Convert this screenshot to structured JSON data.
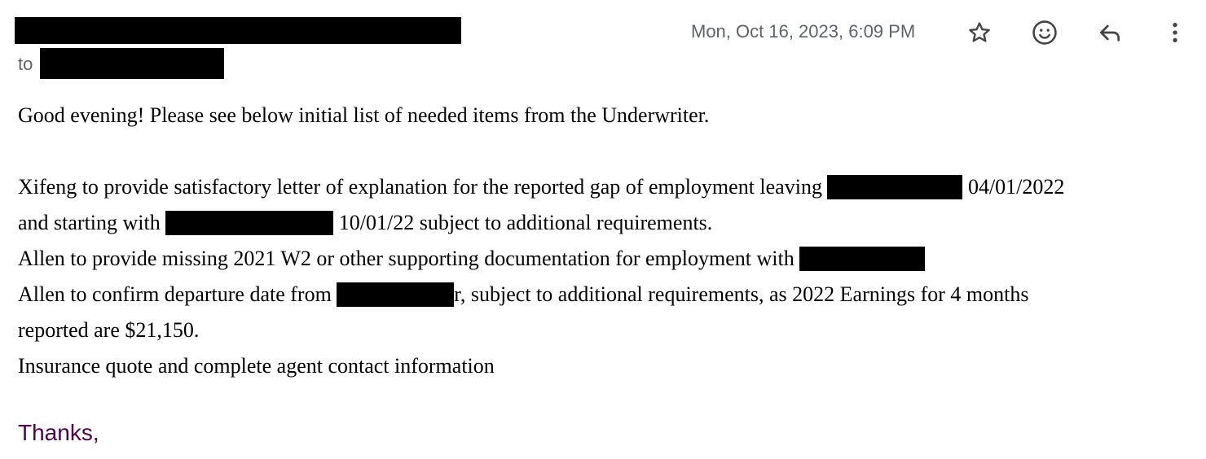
{
  "header": {
    "timestamp": "Mon, Oct 16, 2023, 6:09 PM",
    "to_label": "to",
    "icons": [
      "star-icon",
      "emoji-icon",
      "reply-icon",
      "more-vert-icon"
    ]
  },
  "body": {
    "greeting": "Good evening!  Please see below initial list of needed items from the Underwriter.",
    "item1_part1": "Xifeng to provide satisfactory letter of explanation for the reported gap of employment leaving",
    "item1_part2": " 04/01/2022",
    "item1_part3": "and starting with",
    "item1_part4": " 10/01/22 subject to additional requirements.",
    "item2": "Allen to provide missing 2021 W2 or other supporting documentation for employment with",
    "item3_part1": "Allen to confirm departure date from",
    "item3_part2": "r, subject to additional requirements, as 2022 Earnings for 4 months",
    "item3_part3": "reported are $21,150.",
    "item4": "Insurance quote and complete agent contact information"
  },
  "signature": {
    "thanks": "Thanks,"
  },
  "colors": {
    "meta_text": "#5f6368",
    "body_text": "#000000",
    "signature": "#500050",
    "redaction": "#000000"
  }
}
